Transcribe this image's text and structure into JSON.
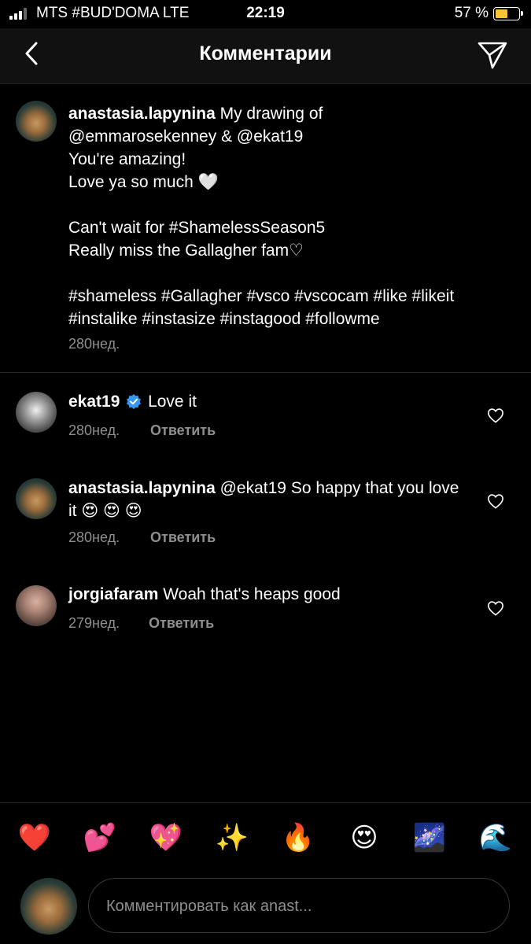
{
  "status_bar": {
    "carrier": "MTS #BUD'DOMA  LTE",
    "time": "22:19",
    "battery_percent": "57 %",
    "battery_level": 0.57,
    "battery_color": "#f7c531"
  },
  "header": {
    "back_icon": "chevron-left-icon",
    "title": "Комментарии",
    "send_icon": "paper-plane-icon"
  },
  "caption": {
    "username": "anastasia.lapynina",
    "lines": [
      "My drawing of",
      "@emmarosekenney & @ekat19",
      "You're amazing!",
      "Love ya so much 🤍",
      "",
      "Can't wait for #ShamelessSeason5",
      "Really miss the Gallagher fam♡",
      "",
      "#shameless #Gallagher #vsco #vscocam #like #likeit",
      "#instalike #instasize #instagood #followme"
    ],
    "time": "280нед."
  },
  "comments": [
    {
      "username": "ekat19",
      "verified": true,
      "text": "Love it",
      "time": "280нед.",
      "reply_label": "Ответить"
    },
    {
      "username": "anastasia.lapynina",
      "verified": false,
      "text": "@ekat19 So happy that you love it 😍 😍 😍",
      "time": "280нед.",
      "reply_label": "Ответить"
    },
    {
      "username": "jorgiafaram",
      "verified": false,
      "text": "Woah that's heaps good",
      "time": "279нед.",
      "reply_label": "Ответить"
    }
  ],
  "emoji_bar": [
    "❤️",
    "💕",
    "💖",
    "✨",
    "🔥",
    "😍",
    "🌌",
    "🌊"
  ],
  "composer": {
    "placeholder": "Комментировать как anast..."
  },
  "colors": {
    "background": "#000000",
    "secondary_text": "#8e8e8e",
    "verified_badge": "#3897f0"
  }
}
